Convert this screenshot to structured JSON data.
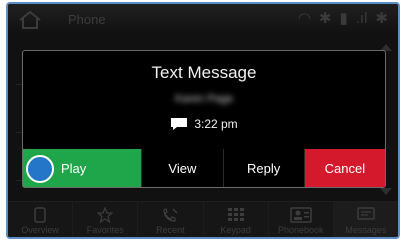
{
  "background": {
    "statusbar": {
      "title": "Phone",
      "icons": [
        "home-icon",
        "wifi-icon",
        "bluetooth-icon",
        "battery-icon",
        "signal-icon",
        "bluetooth-icon"
      ]
    },
    "tabs": [
      {
        "label": "Overview",
        "icon": "phone-icon"
      },
      {
        "label": "Favorites",
        "icon": "star-icon"
      },
      {
        "label": "Recent",
        "icon": "recent-calls-icon"
      },
      {
        "label": "Keypad",
        "icon": "keypad-icon"
      },
      {
        "label": "Phonebook",
        "icon": "contacts-icon"
      },
      {
        "label": "Messages",
        "icon": "message-icon"
      }
    ]
  },
  "dialog": {
    "title": "Text Message",
    "sender": "Karen Page",
    "time": "3:22 pm",
    "icon": "message-bubble-icon",
    "buttons": {
      "play": "Play",
      "view": "View",
      "reply": "Reply",
      "cancel": "Cancel"
    }
  },
  "colors": {
    "play": "#20a64a",
    "cancel": "#d3192b",
    "focus": "#2476c9",
    "frame": "#5b8fc6"
  }
}
